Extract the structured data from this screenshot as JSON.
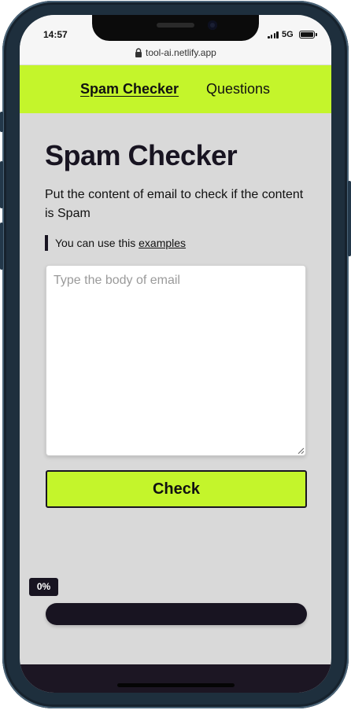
{
  "status_bar": {
    "time": "14:57",
    "network": "5G"
  },
  "browser": {
    "url": "tool-ai.netlify.app"
  },
  "nav": {
    "items": [
      {
        "label": "Spam Checker"
      },
      {
        "label": "Questions"
      }
    ]
  },
  "main": {
    "title": "Spam Checker",
    "intro": "Put the content of email to check if the content is Spam",
    "tip_prefix": "You can use this",
    "tip_link": "examples",
    "input_placeholder": "Type the body of email",
    "input_value": "",
    "check_label": "Check"
  },
  "progress": {
    "label": "0%",
    "value": 0
  },
  "colors": {
    "accent": "#c4f52b",
    "dark": "#181421",
    "background": "#d9d9d9"
  }
}
